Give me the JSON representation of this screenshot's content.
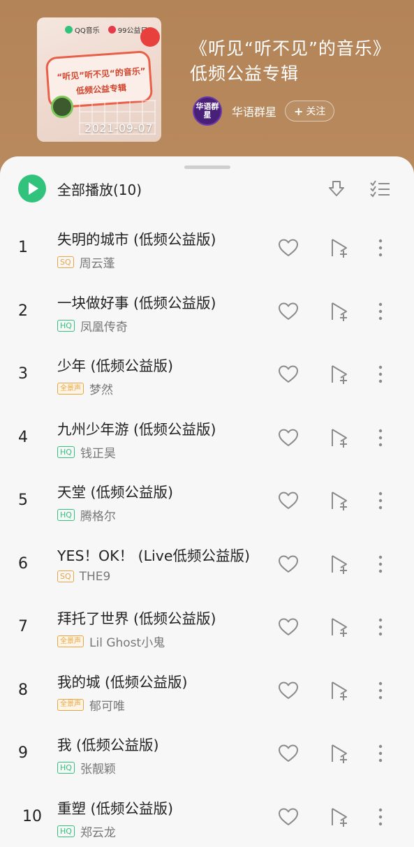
{
  "album": {
    "cover_brand": "QQ音乐",
    "cover_partner": "99公益日",
    "cover_title_line1": "“听见”听不见“的音乐”",
    "cover_title_line2": "低频公益专辑",
    "release_date": "2021-09-07",
    "title": "《听见“听不见”的音乐》低频公益专辑"
  },
  "artist": {
    "avatar_text": "华语群星",
    "name": "华语群星",
    "follow_label": "关注"
  },
  "toolbar": {
    "play_all_label": "全部播放(10)"
  },
  "songs": [
    {
      "index": "1",
      "title": "失明的城市 (低频公益版)",
      "quality": "SQ",
      "artist": "周云蓬"
    },
    {
      "index": "2",
      "title": "一块做好事 (低频公益版)",
      "quality": "HQ",
      "artist": "凤凰传奇"
    },
    {
      "index": "3",
      "title": "少年 (低频公益版)",
      "quality": "全景声",
      "artist": "梦然"
    },
    {
      "index": "4",
      "title": "九州少年游 (低频公益版)",
      "quality": "HQ",
      "artist": "钱正昊"
    },
    {
      "index": "5",
      "title": "天堂 (低频公益版)",
      "quality": "HQ",
      "artist": "腾格尔"
    },
    {
      "index": "6",
      "title": "YES！OK！ (Live低频公益版)",
      "quality": "SQ",
      "artist": "THE9"
    },
    {
      "index": "7",
      "title": "拜托了世界 (低频公益版)",
      "quality": "全景声",
      "artist": "Lil Ghost小鬼"
    },
    {
      "index": "8",
      "title": "我的城 (低频公益版)",
      "quality": "全景声",
      "artist": "郁可唯"
    },
    {
      "index": "9",
      "title": "我 (低频公益版)",
      "quality": "HQ",
      "artist": "张靓颖"
    },
    {
      "index": "10",
      "title": "重塑 (低频公益版)",
      "quality": "HQ",
      "artist": "郑云龙"
    }
  ],
  "colors": {
    "header_bg": "#b7855a",
    "accent_green": "#31c27c",
    "badge_gold": "#e9a544"
  }
}
